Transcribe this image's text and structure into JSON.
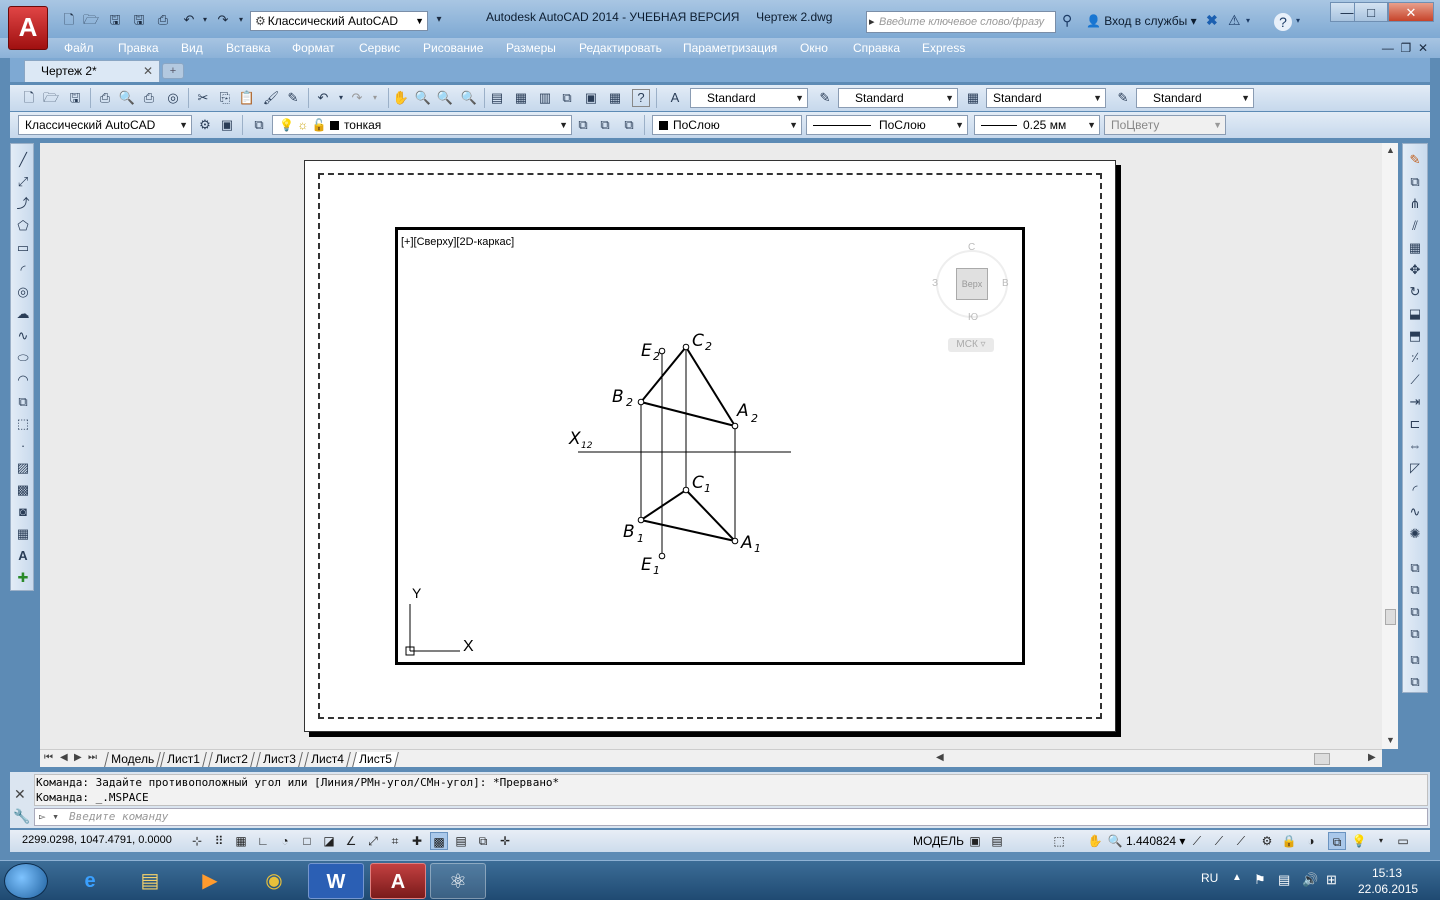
{
  "title_bar": {
    "workspace": "Классический AutoCAD",
    "title": "Autodesk AutoCAD 2014 - УЧЕБНАЯ ВЕРСИЯ     Чертеж 2.dwg",
    "search_placeholder": "Введите ключевое слово/фразу",
    "login": "Вход в службы",
    "minimize": "—",
    "restore": "□",
    "close": "✕"
  },
  "menu": [
    "Файл",
    "Правка",
    "Вид",
    "Вставка",
    "Формат",
    "Сервис",
    "Рисование",
    "Размеры",
    "Редактировать",
    "Параметризация",
    "Окно",
    "Справка",
    "Express"
  ],
  "doc_tab": {
    "name": "Чертеж 2*",
    "close": "✕"
  },
  "toolbar1": {
    "text_style": "Standard",
    "dim_style": "Standard",
    "table_style": "Standard",
    "mleader_style": "Standard"
  },
  "toolbar2": {
    "workspace": "Классический AutoCAD",
    "layer": "тонкая",
    "color": "ПоСлою",
    "linetype": "ПоСлою",
    "lineweight": "0.25 мм",
    "plotstyle": "ПоЦвету"
  },
  "viewport": {
    "label": "[+][Сверху][2D-каркас]",
    "viewcube": {
      "top": "Верх",
      "north": "С",
      "south": "Ю",
      "west": "З",
      "east": "В",
      "wcs": "МСК"
    },
    "ucs": {
      "x": "X",
      "y": "Y"
    }
  },
  "drawing_labels": {
    "E2": "E",
    "E2_sub": "2",
    "C2": "C",
    "C2_sub": "2",
    "B2": "B",
    "B2_sub": "2",
    "A2": "A",
    "A2_sub": "2",
    "X12": "X",
    "X12_sub": "12",
    "C1": "C",
    "C1_sub": "1",
    "B1": "B",
    "B1_sub": "1",
    "A1": "A",
    "A1_sub": "1",
    "E1": "E",
    "E1_sub": "1"
  },
  "sheet_tabs": [
    "Модель",
    "Лист1",
    "Лист2",
    "Лист3",
    "Лист4",
    "Лист5"
  ],
  "active_sheet": "Лист5",
  "command": {
    "history": [
      "Команда: Задайте противоположный угол или [Линия/РМн-угол/СМн-угол]: *Прервано*",
      "Команда: _.MSPACE"
    ],
    "placeholder": "Введите команду"
  },
  "status": {
    "coords": "2299.0298, 1047.4791, 0.0000",
    "space": "МОДЕЛЬ",
    "scale": "1.440824"
  },
  "taskbar": {
    "lang": "RU",
    "time": "15:13",
    "date": "22.06.2015"
  }
}
